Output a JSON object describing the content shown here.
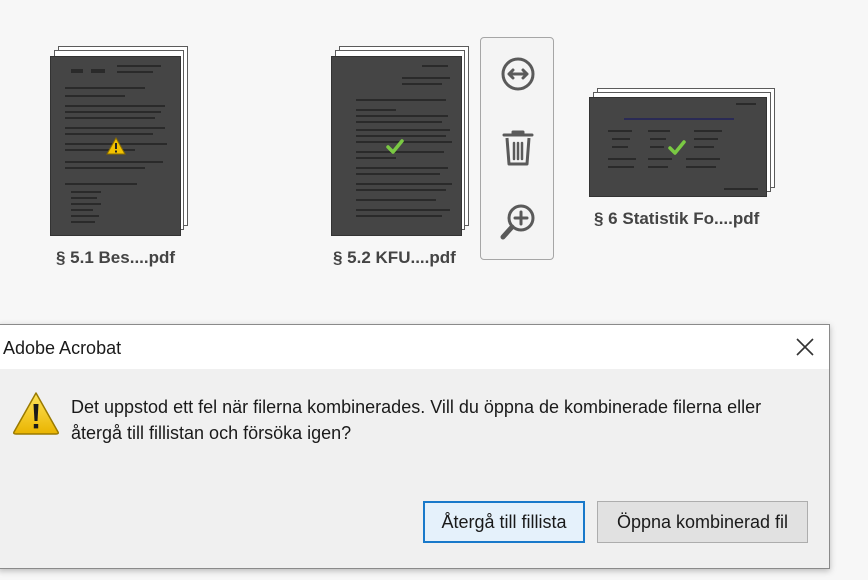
{
  "files": [
    {
      "name": "§ 5.1 Bes....pdf",
      "status": "warning-icon"
    },
    {
      "name": "§ 5.2 KFU....pdf",
      "status": "check-icon"
    },
    {
      "name": "§ 6 Statistik Fo....pdf",
      "status": "check-icon"
    }
  ],
  "actions": [
    {
      "icon": "expand-horizontal-icon"
    },
    {
      "icon": "trash-icon"
    },
    {
      "icon": "zoom-in-icon"
    }
  ],
  "dialog": {
    "title": "Adobe Acrobat",
    "message": "Det uppstod ett fel när filerna kombinerades. Vill du öppna de kombinerade filerna eller återgå till fillistan och försöka igen?",
    "primary_button": "Återgå till fillista",
    "secondary_button": "Öppna kombinerad fil"
  },
  "colors": {
    "accent": "#1979ca",
    "warning": "#f2c200",
    "success": "#7ac943"
  }
}
